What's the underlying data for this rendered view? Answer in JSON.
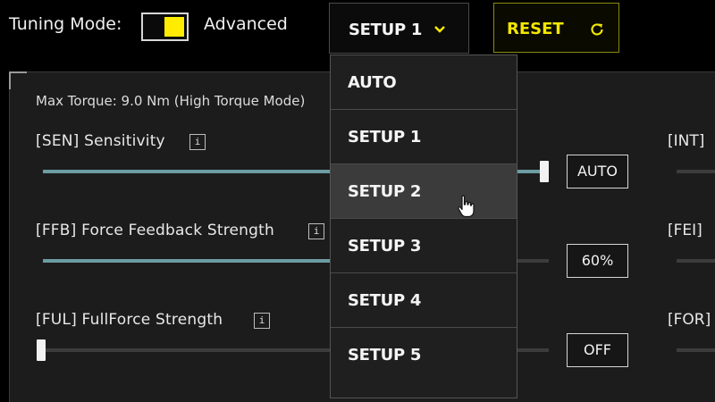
{
  "header": {
    "tuning_mode_label": "Tuning Mode:",
    "tuning_mode_value": "Advanced",
    "setup_selected": "SETUP 1",
    "reset_label": "RESET"
  },
  "colors": {
    "accent_yellow": "#ffec00",
    "slider_fill": "#6d9ca3",
    "panel_bg": "#1c1c1c"
  },
  "panel": {
    "max_torque": "Max Torque: 9.0 Nm (High Torque Mode)",
    "params": [
      {
        "label": "[SEN] Sensitivity",
        "value": "AUTO",
        "level": 1.0
      },
      {
        "label": "[FFB] Force Feedback Strength",
        "value": "60%",
        "level": 0.6
      },
      {
        "label": "[FUL] FullForce Strength",
        "value": "OFF",
        "level": 0.0
      }
    ],
    "right_labels": [
      "[INT]",
      "[FEI]",
      "[FOR]"
    ]
  },
  "dropdown": {
    "options": [
      "AUTO",
      "SETUP 1",
      "SETUP 2",
      "SETUP 3",
      "SETUP 4",
      "SETUP 5"
    ],
    "hovered": "SETUP 2"
  },
  "icons": {
    "chevron": "chevron-down-icon",
    "reset": "refresh-icon",
    "info": "info-icon",
    "cursor": "hand-pointer-icon"
  }
}
